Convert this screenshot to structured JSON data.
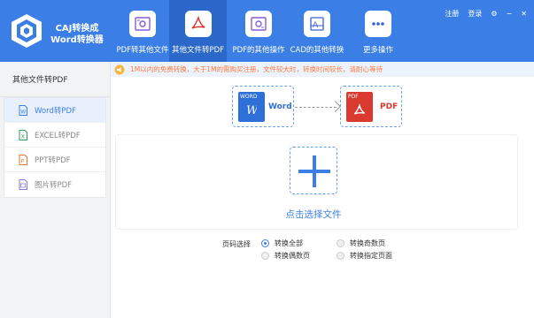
{
  "app": {
    "title_line1": "CAJ转换成",
    "title_line2": "Word转换器"
  },
  "nav": [
    {
      "label": "PDF转其他文件",
      "icon": "gear-doc-icon"
    },
    {
      "label": "其他文件转PDF",
      "icon": "acrobat-icon"
    },
    {
      "label": "PDF的其他操作",
      "icon": "gear-doc-icon"
    },
    {
      "label": "CAD的其他转换",
      "icon": "cad-icon"
    },
    {
      "label": "更多操作",
      "icon": "more-dots-icon"
    }
  ],
  "window": {
    "register": "注册",
    "login": "登录",
    "settings_glyph": "⚙",
    "minimize_glyph": "−",
    "close_glyph": "✕"
  },
  "sidebar": {
    "header": "其他文件转PDF",
    "items": [
      {
        "label": "Word转PDF",
        "icon": "word-file-icon"
      },
      {
        "label": "EXCEL转PDF",
        "icon": "excel-file-icon"
      },
      {
        "label": "PPT转PDF",
        "icon": "ppt-file-icon"
      },
      {
        "label": "图片转PDF",
        "icon": "image-file-icon"
      }
    ]
  },
  "notice": {
    "text": "1M以内的免费转换，大于1M的需购买注册，文件较大时，转换时间较长，请耐心等待"
  },
  "conversion": {
    "from_tag": "WORD",
    "from_name": "Word",
    "to_tag": "PDF",
    "to_name": "PDF"
  },
  "upload": {
    "label": "点击选择文件"
  },
  "page_select": {
    "label": "页码选择",
    "options": [
      "转换全部",
      "转换奇数页",
      "转换偶数页",
      "转换指定页面"
    ],
    "selected": "转换全部"
  },
  "colors": {
    "primary": "#3b7fe6",
    "word_blue": "#2f6fd8",
    "pdf_red": "#d9392f",
    "notice_orange": "#ff7a3d"
  }
}
